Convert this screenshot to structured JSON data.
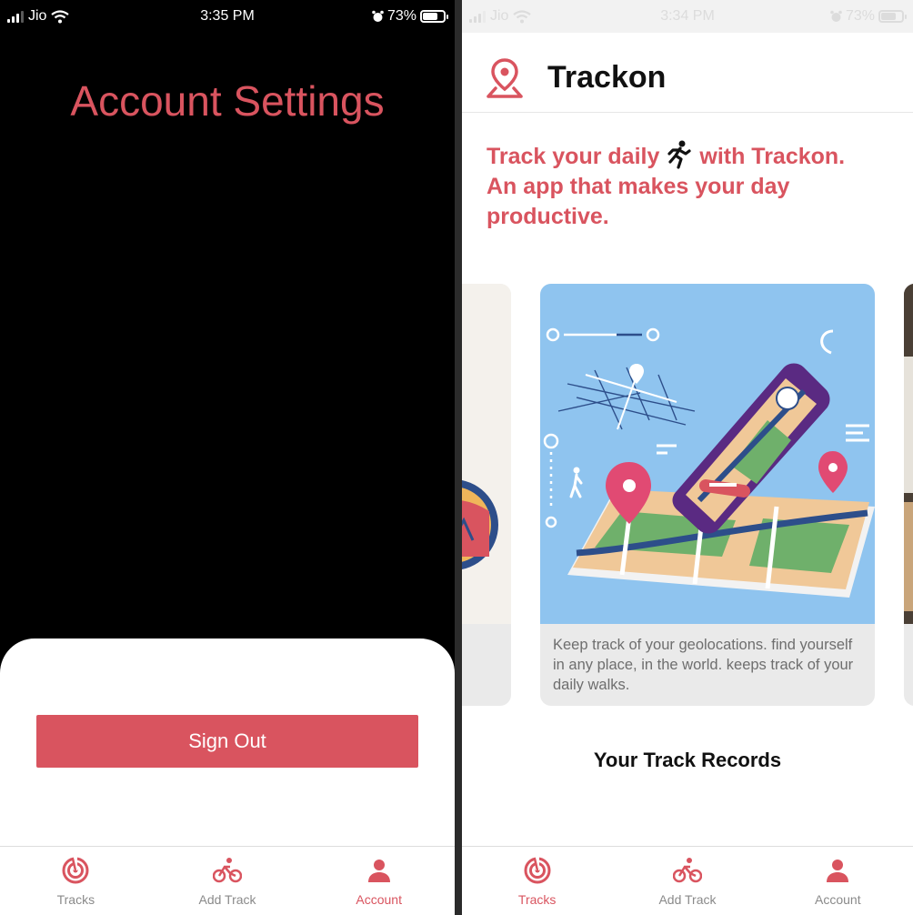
{
  "left_screen": {
    "status_bar": {
      "carrier": "Jio",
      "time": "3:35 PM",
      "battery": "73%"
    },
    "title": "Account Settings",
    "sign_out_label": "Sign Out"
  },
  "right_screen": {
    "status_bar": {
      "carrier": "Jio",
      "time": "3:34 PM",
      "battery": "73%"
    },
    "app_name": "Trackon",
    "tagline": {
      "before_icon": "Track your daily",
      "after_icon": "with Trackon.",
      "line2": "An app that makes your day productive."
    },
    "card": {
      "description": "Keep track of your geolocations. find yourself in any place, in the world. keeps track of your daily walks."
    },
    "section_title": "Your Track Records"
  },
  "tab_bar": {
    "tabs": [
      {
        "label": "Tracks",
        "icon": "radar-icon"
      },
      {
        "label": "Add Track",
        "icon": "bicycle-icon"
      },
      {
        "label": "Account",
        "icon": "person-icon"
      }
    ]
  },
  "colors": {
    "accent": "#d9545f",
    "map_blue": "#8fc4ef",
    "text_gray": "#6e6e6e"
  },
  "battery_level": 0.73
}
